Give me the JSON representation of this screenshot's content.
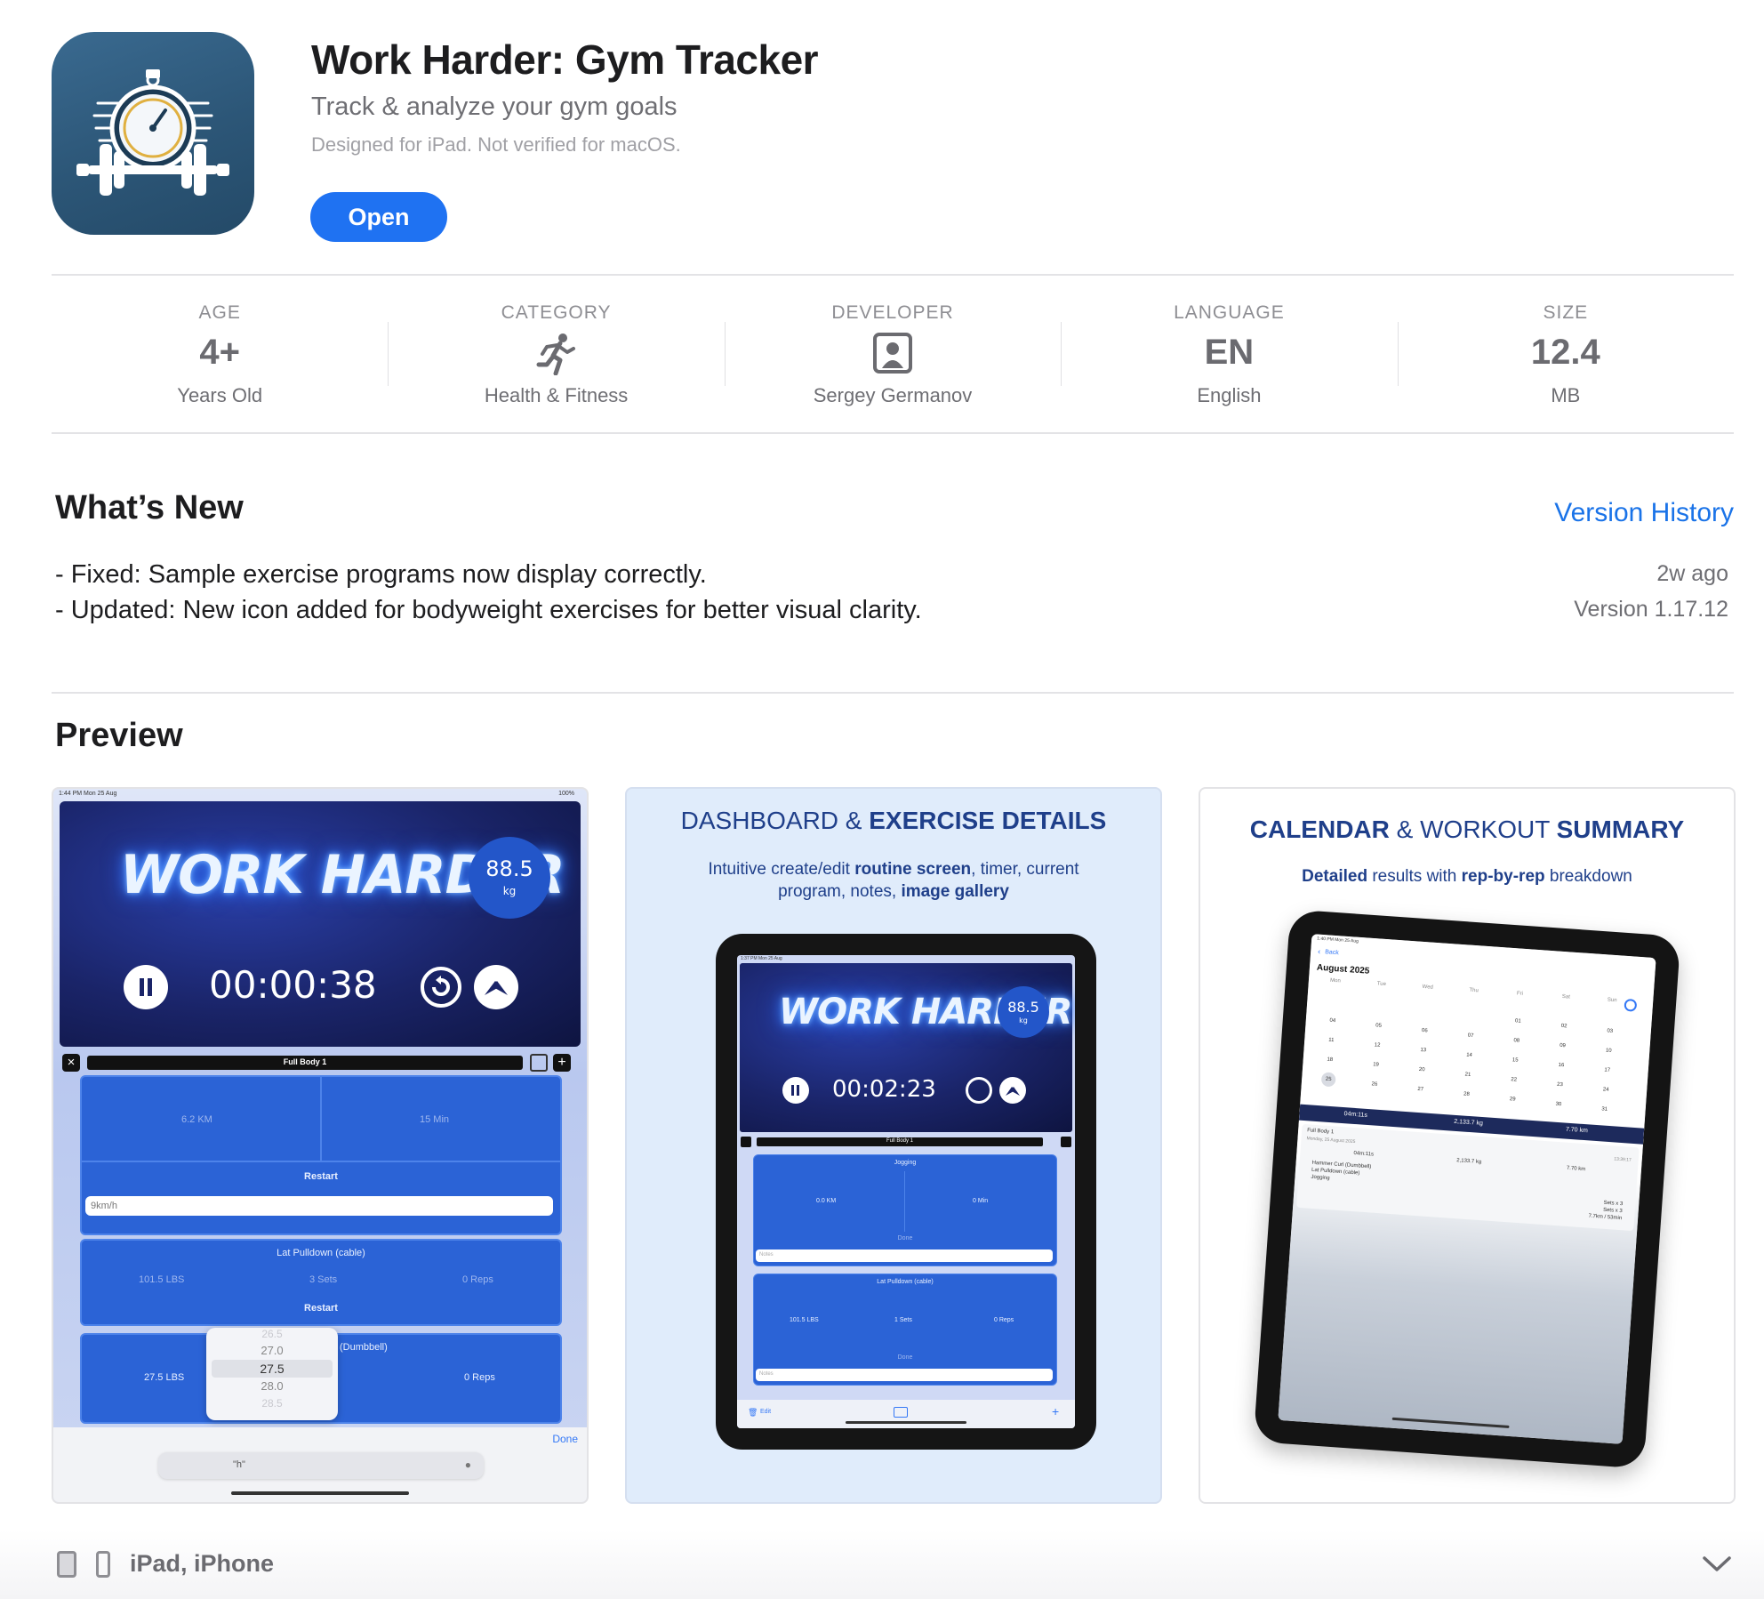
{
  "app": {
    "title": "Work Harder: Gym Tracker",
    "subtitle": "Track & analyze your gym goals",
    "note": "Designed for iPad. Not verified for macOS.",
    "open_label": "Open",
    "icon": "stopwatch-barbell-icon"
  },
  "info": [
    {
      "label": "AGE",
      "value": "4+",
      "sub": "Years Old"
    },
    {
      "label": "CATEGORY",
      "icon": "running-figure-icon",
      "sub": "Health & Fitness"
    },
    {
      "label": "DEVELOPER",
      "icon": "person-portrait-icon",
      "sub": "Sergey Germanov"
    },
    {
      "label": "LANGUAGE",
      "value": "EN",
      "sub": "English"
    },
    {
      "label": "SIZE",
      "value": "12.4",
      "sub": "MB"
    }
  ],
  "whats_new": {
    "title": "What’s New",
    "version_history_label": "Version History",
    "notes": [
      "- Fixed: Sample exercise programs now display correctly.",
      "- Updated: New icon added for bodyweight exercises for better visual clarity."
    ],
    "date": "2w ago",
    "version": "Version 1.17.12"
  },
  "preview": {
    "title": "Preview",
    "shot1": {
      "status_time": "1:44 PM   Mon 25 Aug",
      "status_battery": "100%",
      "neon": "WORK HARDER",
      "weight_value": "88.5",
      "weight_unit": "kg",
      "timer": "00:00:38",
      "program": "Full Body 1",
      "dist": "6.2 KM",
      "mins": "15 Min",
      "restart": "Restart",
      "note_input": "9km/h",
      "ex2_name": "Lat Pulldown (cable)",
      "ex2_lbs": "101.5 LBS",
      "ex2_sets": "3 Sets",
      "ex2_reps": "0 Reps",
      "ex3_name": "(Dumbbell)",
      "ex3_lbs": "27.5 LBS",
      "ex3_reps": "0 Reps",
      "picker": [
        "26.5",
        "27.0",
        "27.5",
        "28.0",
        "28.5"
      ],
      "done": "Done",
      "kbd_suggest": "\"h\""
    },
    "shot2": {
      "heading_a": "DASHBOARD & ",
      "heading_b": "EXERCISE DETAILS",
      "desc_1": "Intuitive create/edit ",
      "desc_2": "routine screen",
      "desc_3": ", timer, current program, notes, ",
      "desc_4": "image gallery",
      "neon": "WORK HARDER",
      "weight_value": "88.5",
      "weight_unit": "kg",
      "timer": "00:02:23",
      "status_time": "1:37 PM   Mon 25 Aug",
      "program": "Full Body 1",
      "ex1": "Jogging",
      "ex1_km": "0.0 KM",
      "ex1_min": "0 Min",
      "done": "Done",
      "notes": "Notes",
      "ex2": "Lat Pulldown (cable)",
      "ex2_lbs": "101.5 LBS",
      "ex2_sets": "1 Sets",
      "ex2_reps": "0 Reps",
      "edit": "Edit"
    },
    "shot3": {
      "heading_a": "CALENDAR",
      "heading_b": " & WORKOUT ",
      "heading_c": "SUMMARY",
      "desc_a": "Detailed",
      "desc_b": " results with ",
      "desc_c": "rep-by-rep",
      "desc_d": " breakdown",
      "status_time": "1:40 PM   Mon 25 Aug",
      "back": "Back",
      "month": "August 2025",
      "weekdays": [
        "Mon",
        "Tue",
        "Wed",
        "Thu",
        "Fri",
        "Sat",
        "Sun"
      ],
      "days": [
        "",
        "",
        "",
        "",
        "01",
        "02",
        "03",
        "04",
        "05",
        "06",
        "07",
        "08",
        "09",
        "10",
        "11",
        "12",
        "13",
        "14",
        "15",
        "16",
        "17",
        "18",
        "19",
        "20",
        "21",
        "22",
        "23",
        "24",
        "25",
        "26",
        "27",
        "28",
        "29",
        "30",
        "31"
      ],
      "stat_time": "04m:11s",
      "stat_weight": "2,133.7 kg",
      "stat_dist": "7.70 km",
      "workout_name": "Full Body 1",
      "workout_date": "Monday, 25 August 2025",
      "workout_time": "13:39:17",
      "exercises": [
        "Hammer Curl (Dumbbell)",
        "Lat Pulldown (cable)",
        "Jogging"
      ],
      "sets": [
        "Sets x 3",
        "Sets x 3",
        "7.7km / 53min"
      ]
    }
  },
  "footer": {
    "devices": "iPad, iPhone",
    "ipad_icon": "ipad-icon",
    "iphone_icon": "iphone-icon",
    "expand_icon": "chevron-down-icon"
  }
}
